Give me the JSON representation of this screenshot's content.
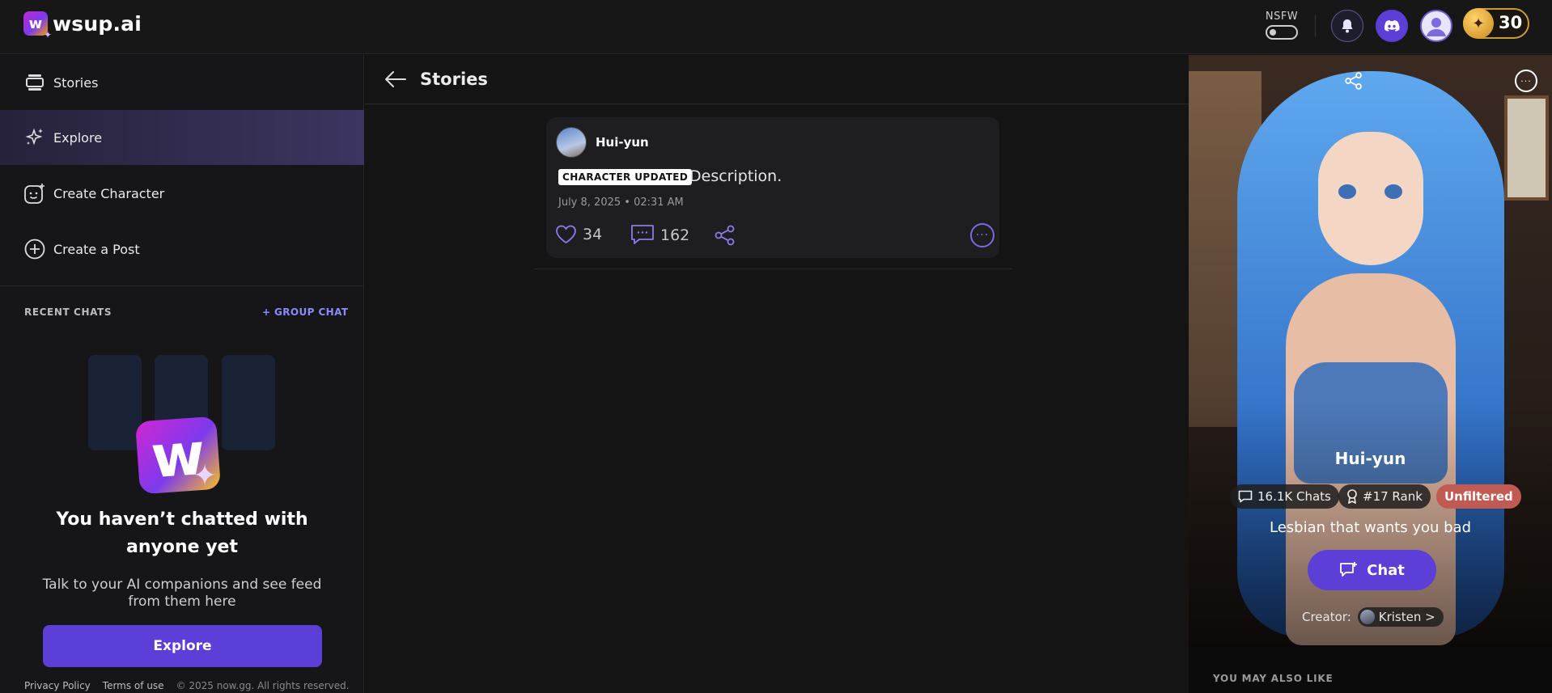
{
  "app": {
    "logo_text": "wsup.ai",
    "logo_letter": "w"
  },
  "topbar": {
    "nsfw_label": "NSFW",
    "coins": "30"
  },
  "sidebar": {
    "items": [
      {
        "label": "Stories",
        "icon": "stories-icon"
      },
      {
        "label": "Explore",
        "icon": "sparkle-icon"
      },
      {
        "label": "Create Character",
        "icon": "face-plus-icon"
      },
      {
        "label": "Create a Post",
        "icon": "plus-circle-icon"
      }
    ],
    "recent_chats_label": "RECENT CHATS",
    "group_chat_label": "+ GROUP CHAT",
    "empty_title": "You haven’t chatted with anyone yet",
    "empty_subtitle": "Talk to your AI companions and see feed from them here",
    "explore_button": "Explore",
    "footer": {
      "privacy": "Privacy Policy",
      "terms": "Terms of use",
      "copyright": "© 2025 now.gg. All rights reserved."
    }
  },
  "main": {
    "title": "Stories",
    "post": {
      "author": "Hui-yun",
      "badge": "CHARACTER UPDATED",
      "description": "Description.",
      "date": "July 8, 2025 • 02:31 AM",
      "likes": "34",
      "comments": "162"
    }
  },
  "character": {
    "name": "Hui-yun",
    "chats": "16.1K Chats",
    "rank": "#17 Rank",
    "tag": "Unfiltered",
    "tagline": "Lesbian that wants you bad",
    "chat_button": "Chat",
    "creator_label": "Creator:",
    "creator_name": "Kristen >",
    "also_like_label": "YOU MAY ALSO LIKE"
  },
  "colors": {
    "accent": "#5b3fd6",
    "unfiltered": "#c05a52",
    "coin": "#c89b3c",
    "link": "#8b8bff"
  }
}
